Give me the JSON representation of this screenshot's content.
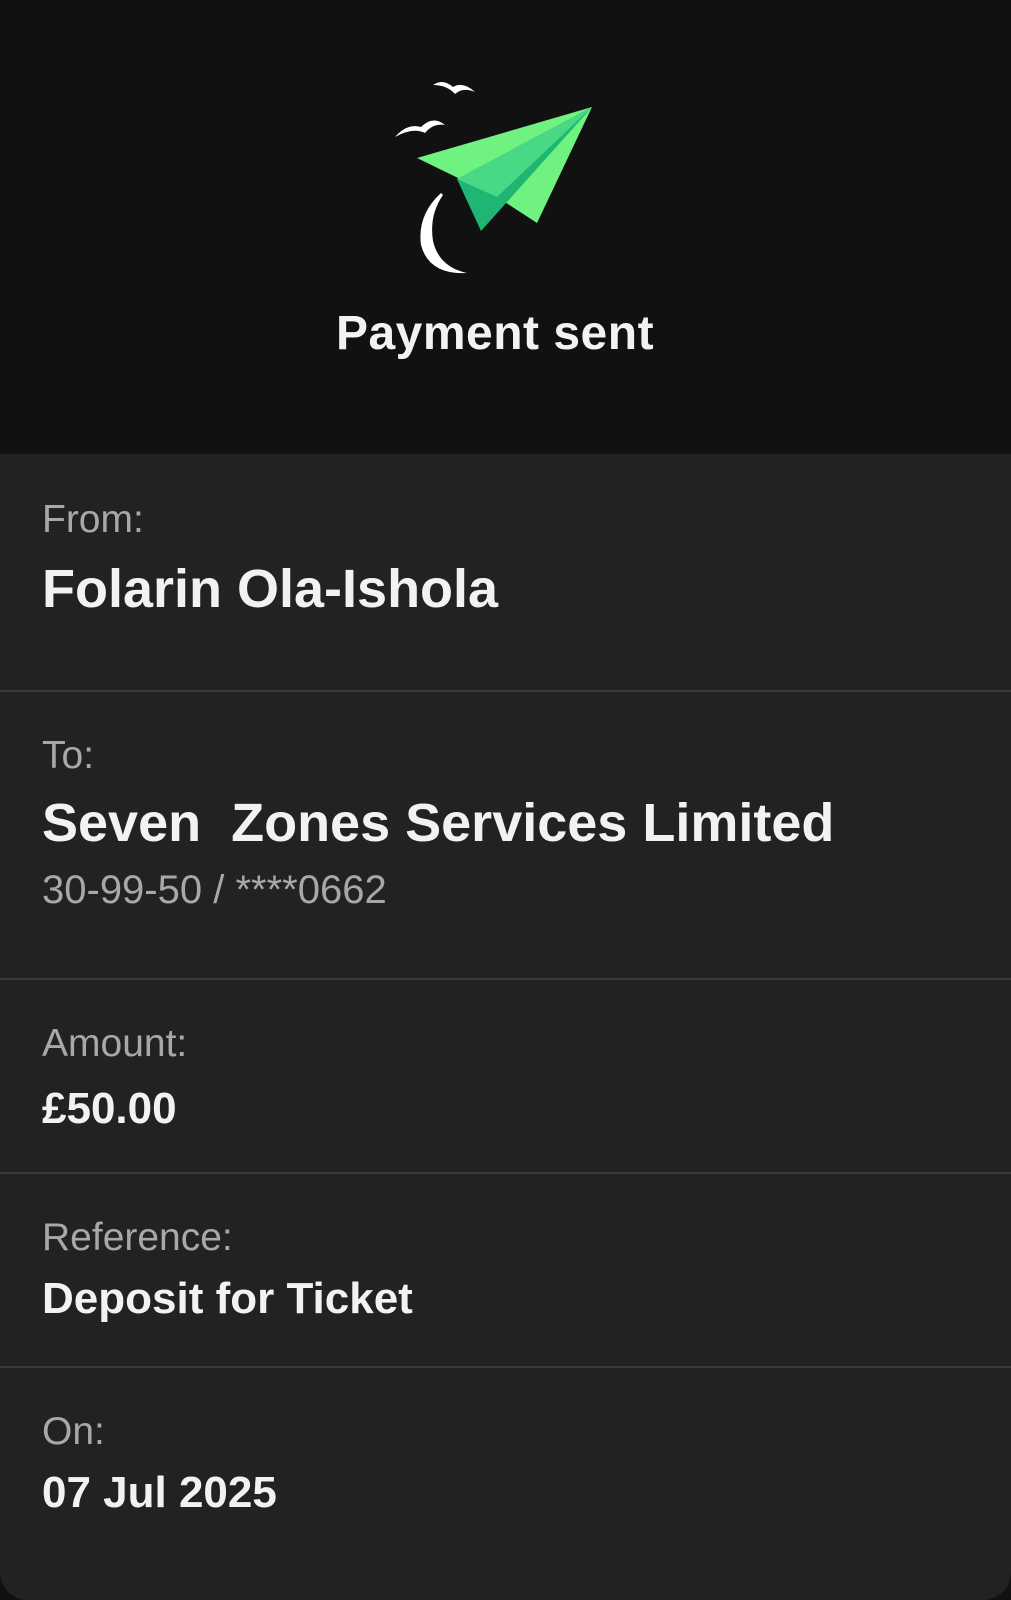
{
  "header": {
    "title": "Payment sent",
    "colors": {
      "background": "#111111",
      "plane_light": "#6ff27f",
      "plane_dark": "#1fb573"
    }
  },
  "details": {
    "from": {
      "label": "From:",
      "value": "Folarin Ola-Ishola"
    },
    "to": {
      "label": "To:",
      "value": "Seven  Zones Services Limited",
      "account": "30-99-50 / ****0662"
    },
    "amount": {
      "label": "Amount:",
      "value": "£50.00"
    },
    "reference": {
      "label": "Reference:",
      "value": "Deposit for Ticket"
    },
    "date": {
      "label": "On:",
      "value": "07 Jul 2025"
    }
  }
}
